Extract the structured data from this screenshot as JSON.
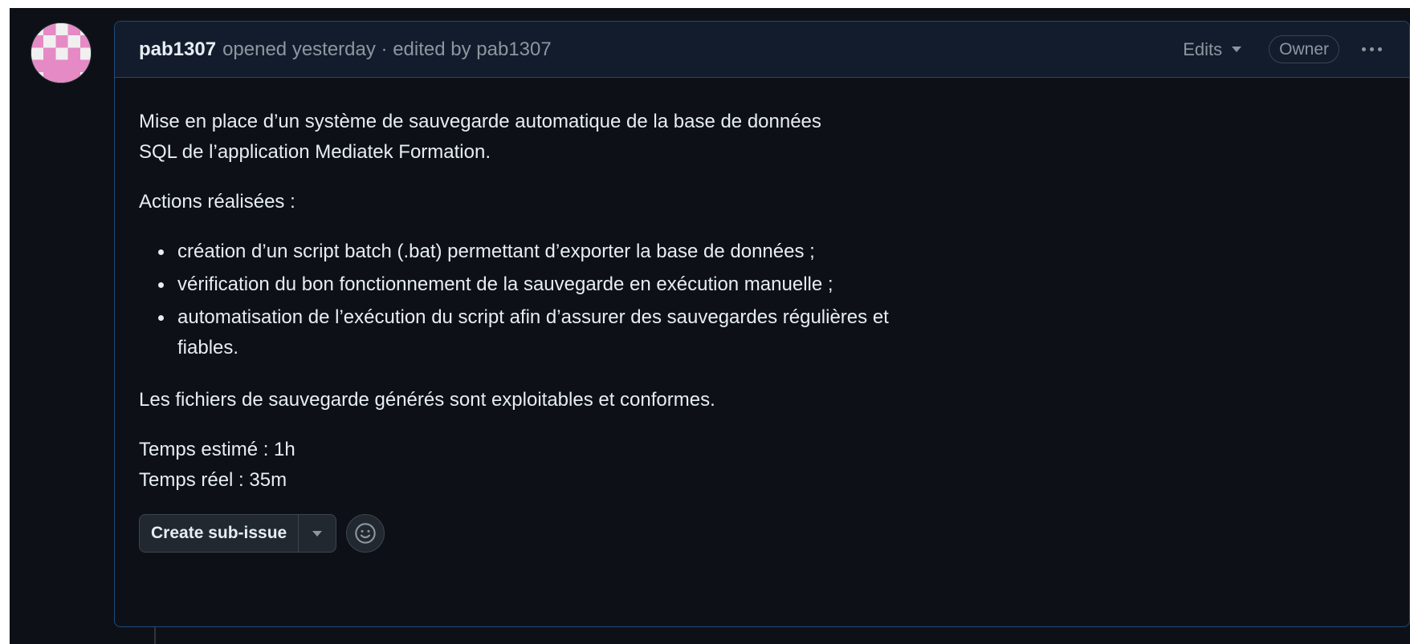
{
  "header": {
    "author": "pab1307",
    "meta_text": "opened yesterday · edited by pab1307",
    "edits_label": "Edits",
    "role_badge": "Owner"
  },
  "body": {
    "intro_line1": "Mise en place d’un système de sauvegarde automatique de la base de données",
    "intro_line2": "SQL de l’application Mediatek Formation.",
    "actions_heading": "Actions réalisées :",
    "actions": [
      "création d’un script batch (.bat) permettant d’exporter la base de données ;",
      "vérification du bon fonctionnement de la sauvegarde en exécution manuelle ;",
      "automatisation de l’exécution du script afin d’assurer des sauvegardes régulières et fiables."
    ],
    "conclusion": "Les fichiers de sauvegarde générés sont exploitables et conformes.",
    "time_estimated": "Temps estimé : 1h",
    "time_actual": "Temps réel : 35m"
  },
  "toolbar": {
    "create_sub_issue_label": "Create sub-issue"
  },
  "icons": {
    "avatar": "identicon-avatar",
    "edits_caret": "chevron-down-icon",
    "more": "kebab-horizontal-icon",
    "dropdown": "triangle-down-icon",
    "reaction": "smiley-icon"
  },
  "colors": {
    "background": "#0d1117",
    "header_background": "#121c2c",
    "border_accent": "#1f4a7a",
    "text_primary": "#e6edf3",
    "text_muted": "#8d96a0",
    "avatar_pink": "#e58ac4"
  }
}
